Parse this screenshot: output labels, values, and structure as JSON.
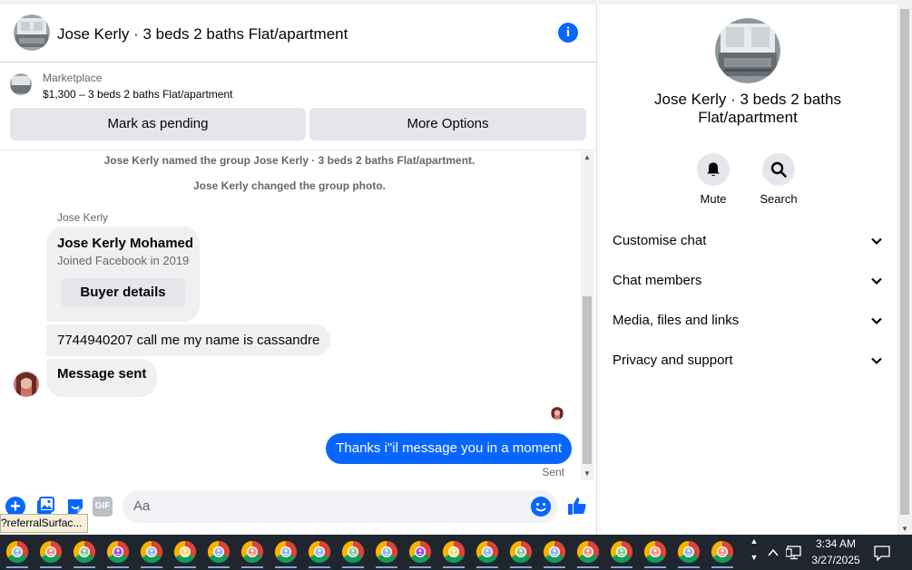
{
  "header": {
    "title": "Jose Kerly · 3 beds 2 baths Flat/apartment",
    "info_icon": "info-icon"
  },
  "marketplace": {
    "label": "Marketplace",
    "listing": "$1,300 – 3 beds 2 baths Flat/apartment",
    "pending_button": "Mark as pending",
    "more_button": "More Options"
  },
  "messages": {
    "system": [
      "Jose Kerly named the group Jose Kerly · 3 beds 2 baths Flat/apartment.",
      "Jose Kerly changed the group photo."
    ],
    "sender_name": "Jose Kerly",
    "card": {
      "name": "Jose Kerly Mohamed",
      "joined": "Joined Facebook in 2019",
      "button": "Buyer details"
    },
    "incoming": [
      "7744940207 call me my name is cassandre",
      "Message sent"
    ],
    "outgoing": "Thanks i\"il message you in a moment",
    "status": "Sent"
  },
  "composer": {
    "placeholder": "Aa",
    "gif_label": "GIF",
    "tooltip": "?referralSurfac..."
  },
  "info_panel": {
    "title": "Jose Kerly · 3 beds 2 baths Flat/apartment",
    "actions": [
      {
        "label": "Mute",
        "icon": "bell-icon"
      },
      {
        "label": "Search",
        "icon": "search-icon"
      }
    ],
    "sections": [
      "Customise chat",
      "Chat members",
      "Media, files and links",
      "Privacy and support"
    ]
  },
  "taskbar": {
    "time": "3:34 AM",
    "date": "3/27/2025",
    "app_count": 22,
    "app_icon": "chrome-icon"
  },
  "colors": {
    "accent": "#0866ff",
    "bubble_gray": "#f0f0f0",
    "taskbar": "#20262e"
  }
}
